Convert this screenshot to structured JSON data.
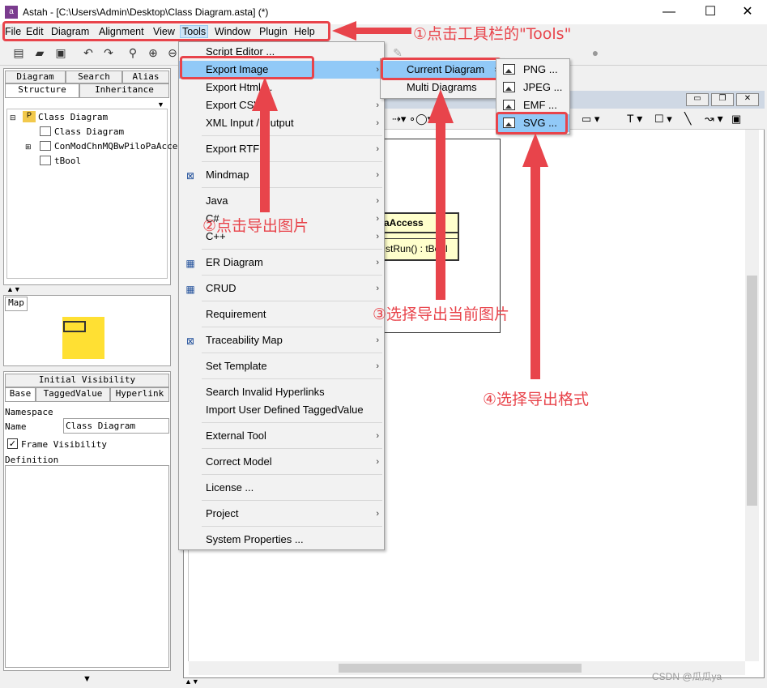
{
  "window": {
    "title": "Astah - [C:\\Users\\Admin\\Desktop\\Class Diagram.asta] (*)",
    "app_icon_text": "a",
    "controls": {
      "minimize": "—",
      "maximize": "☐",
      "close": "✕"
    }
  },
  "menubar": [
    "File",
    "Edit",
    "Diagram",
    "Alignment",
    "View",
    "Tools",
    "Window",
    "Plugin",
    "Help"
  ],
  "left_panel": {
    "top_tabs_row1": [
      "Diagram",
      "Search",
      "Alias"
    ],
    "top_tabs_row2": [
      "Structure",
      "Inheritance"
    ],
    "tree": [
      "Class Diagram",
      "Class Diagram",
      "ConModChnMQBwPiloPaAcce",
      "tBool"
    ],
    "map_tab": "Map",
    "bottom_tab_row1": [
      "Initial Visibility"
    ],
    "bottom_tab_row2": [
      "Base",
      "TaggedValue",
      "Hyperlink"
    ],
    "props": {
      "namespace_label": "Namespace",
      "name_label": "Name",
      "name_value": "Class Diagram",
      "frame_visibility_label": "Frame Visibility",
      "definition_label": "Definition"
    }
  },
  "diagram": {
    "class_name_fragment": "aAccess",
    "class_method_fragment": "stRun() : tBool"
  },
  "tools_menu": {
    "items": [
      "Script Editor ...",
      "Export Image",
      "Export Html ...",
      "Export CSV",
      "XML Input / Output",
      "Export RTF",
      "Mindmap",
      "Java",
      "C#",
      "C++",
      "ER Diagram",
      "CRUD",
      "Requirement",
      "Traceability Map",
      "Set Template",
      "Search Invalid Hyperlinks",
      "Import User Defined TaggedValue",
      "External Tool",
      "Correct Model",
      "License ...",
      "Project",
      "System Properties ..."
    ]
  },
  "export_image_menu": [
    "Current Diagram",
    "Multi Diagrams"
  ],
  "format_menu": [
    "PNG ...",
    "JPEG ...",
    "EMF ...",
    "SVG ..."
  ],
  "annotations": {
    "step1": "①点击工具栏的\"Tools\"",
    "step2": "②点击导出图片",
    "step3": "③选择导出当前图片",
    "step4": "④选择导出格式"
  },
  "watermark": "CSDN @瓜瓜ya",
  "colors": {
    "annotation_red": "#e8444b",
    "highlight": "#91c9f7",
    "class_fill": "#ffffcc",
    "map_fill": "#ffe033"
  }
}
